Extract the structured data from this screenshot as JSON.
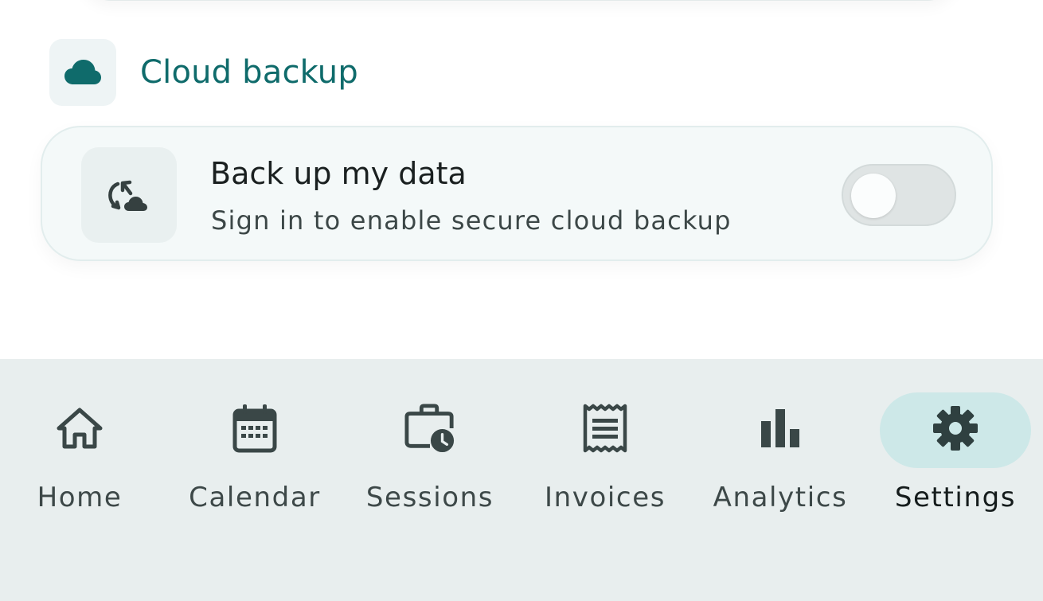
{
  "section": {
    "title": "Cloud backup",
    "icon": "cloud-icon"
  },
  "backup_card": {
    "icon": "cloud-sync-icon",
    "title": "Back up my data",
    "subtitle": "Sign in to enable secure cloud backup",
    "toggle_on": false
  },
  "nav": {
    "items": [
      {
        "label": "Home",
        "icon": "home-icon"
      },
      {
        "label": "Calendar",
        "icon": "calendar-icon"
      },
      {
        "label": "Sessions",
        "icon": "briefcase-clock-icon"
      },
      {
        "label": "Invoices",
        "icon": "receipt-icon"
      },
      {
        "label": "Analytics",
        "icon": "bar-chart-icon"
      },
      {
        "label": "Settings",
        "icon": "gear-icon"
      }
    ],
    "active": "Settings"
  },
  "colors": {
    "accent": "#0f6b6b",
    "icon": "#3a4a4a",
    "nav_background": "#e8eeee",
    "active_pill": "#cde8e8"
  }
}
